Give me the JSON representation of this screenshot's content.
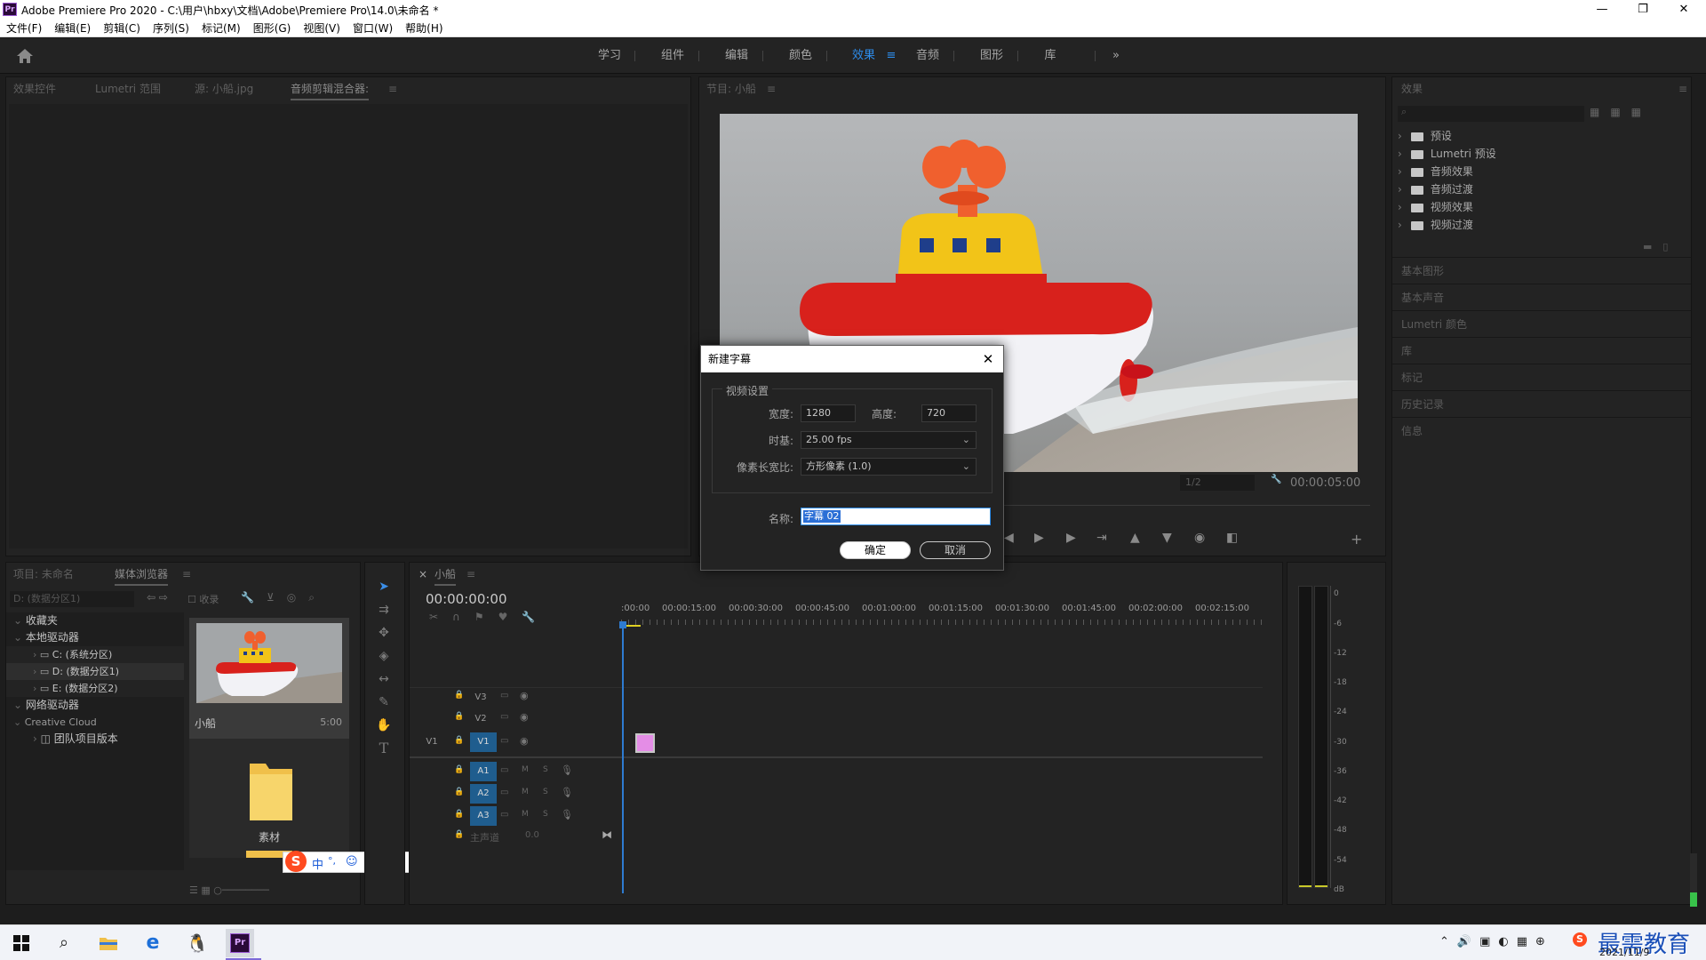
{
  "window": {
    "logo": "Pr",
    "title": "Adobe Premiere Pro 2020 - C:\\用户\\hbxy\\文档\\Adobe\\Premiere Pro\\14.0\\未命名 *",
    "minimize": "—",
    "restore": "❐",
    "close": "✕"
  },
  "menu": [
    "文件(F)",
    "编辑(E)",
    "剪辑(C)",
    "序列(S)",
    "标记(M)",
    "图形(G)",
    "视图(V)",
    "窗口(W)",
    "帮助(H)"
  ],
  "workspaces": {
    "items": [
      "学习",
      "组件",
      "编辑",
      "颜色",
      "效果",
      "音频",
      "图形",
      "库"
    ],
    "active": "效果",
    "overflow": "»",
    "menu_icon": "≡"
  },
  "source_panel": {
    "tabs": [
      "效果控件",
      "Lumetri 范围",
      "源: 小船.jpg",
      "音频剪辑混合器:",
      "≡"
    ]
  },
  "program_panel": {
    "tab": "节目: 小船",
    "menu_icon": "≡",
    "zoom": "1/2",
    "duration": "00:00:05:00"
  },
  "effects_panel": {
    "title": "效果",
    "menu_icon": "≡",
    "items": [
      "预设",
      "Lumetri 预设",
      "音频效果",
      "音频过渡",
      "视频效果",
      "视频过渡"
    ],
    "collapsed": [
      "基本图形",
      "基本声音",
      "Lumetri 颜色",
      "库",
      "标记",
      "历史记录",
      "信息"
    ]
  },
  "project_panel": {
    "tabs": [
      "项目: 未命名",
      "媒体浏览器",
      "≡"
    ],
    "drive_select": "D: (数据分区1)",
    "favorites_checkbox": "收录",
    "tree": {
      "favorites": "收藏夹",
      "local": "本地驱动器",
      "drives": [
        "C: (系统分区)",
        "D: (数据分区1)",
        "E: (数据分区2)"
      ],
      "network": "网络驱动器",
      "cloud": "Creative Cloud",
      "team": "团队项目版本"
    },
    "media": [
      {
        "name": "小船",
        "duration": "5:00"
      },
      {
        "name": "素材",
        "duration": ""
      }
    ]
  },
  "timeline": {
    "close": "×",
    "tab": "小船",
    "menu_icon": "≡",
    "timecode": "00:00:00:00",
    "ruler": [
      ":00:00",
      "00:00:15:00",
      "00:00:30:00",
      "00:00:45:00",
      "00:01:00:00",
      "00:01:15:00",
      "00:01:30:00",
      "00:01:45:00",
      "00:02:00:00",
      "00:02:15:00"
    ],
    "video_tracks": [
      "V3",
      "V2",
      "V1"
    ],
    "source_patch": "V1",
    "audio_tracks": [
      "A1",
      "A2",
      "A3"
    ],
    "master": {
      "label": "主声道",
      "value": "0.0"
    },
    "track_m": "M",
    "track_s": "S"
  },
  "meters": {
    "scale": [
      "0",
      "-6",
      "-12",
      "-18",
      "-24",
      "-30",
      "-36",
      "-42",
      "-48",
      "-54",
      "dB"
    ]
  },
  "dialog": {
    "title": "新建字幕",
    "section": "视频设置",
    "width_label": "宽度:",
    "width_value": "1280",
    "height_label": "高度:",
    "height_value": "720",
    "timebase_label": "时基:",
    "timebase_value": "25.00 fps",
    "par_label": "像素长宽比:",
    "par_value": "方形像素 (1.0)",
    "name_label": "名称:",
    "name_value": "字幕 02",
    "ok": "确定",
    "cancel": "取消"
  },
  "ime": {
    "mode": "中",
    "punct": "°,"
  },
  "taskbar": {
    "date": "2021/11/9",
    "watermark": "最需教育"
  },
  "colors": {
    "accent": "#2d8ceb",
    "track_blue": "#1f5d8e",
    "clip_pink": "#e48de6",
    "playhead": "#2e7bd1",
    "boat_red": "#d8211c",
    "boat_yellow": "#f2c418"
  }
}
